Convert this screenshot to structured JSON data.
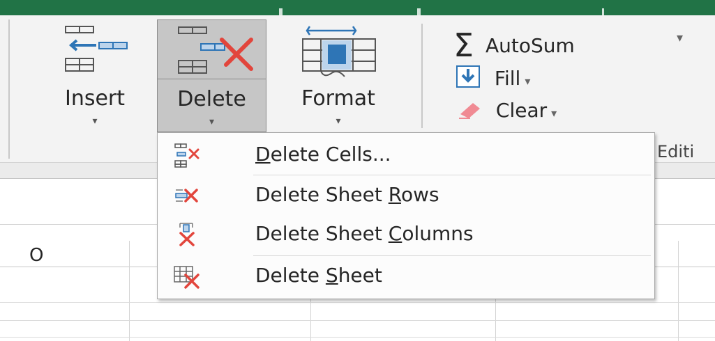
{
  "ribbon": {
    "cells_group": {
      "insert": {
        "label": "Insert",
        "dropdown_glyph": "▾",
        "icon": "insert-cells-icon"
      },
      "delete": {
        "label": "Delete",
        "dropdown_glyph": "▾",
        "icon": "delete-cells-icon",
        "state": "pressed"
      },
      "format": {
        "label": "Format",
        "dropdown_glyph": "▾",
        "icon": "format-cells-icon"
      }
    },
    "editing_group": {
      "autosum": {
        "label": "AutoSum",
        "dropdown_glyph": "▾",
        "icon": "sigma-icon"
      },
      "fill": {
        "label": "Fill",
        "dropdown_glyph": "▾",
        "icon": "fill-down-arrow-icon"
      },
      "clear": {
        "label": "Clear",
        "dropdown_glyph": "▾",
        "icon": "eraser-icon"
      },
      "group_label": "Editi"
    }
  },
  "grid": {
    "column_header": "O"
  },
  "delete_menu": {
    "items": [
      {
        "pre": "",
        "key": "D",
        "post": "elete Cells...",
        "icon": "delete-cells-icon"
      },
      {
        "pre": "Delete Sheet ",
        "key": "R",
        "post": "ows",
        "icon": "delete-rows-icon"
      },
      {
        "pre": "Delete Sheet ",
        "key": "C",
        "post": "olumns",
        "icon": "delete-columns-icon"
      },
      {
        "pre": "Delete ",
        "key": "S",
        "post": "heet",
        "icon": "delete-sheet-icon"
      }
    ]
  },
  "colors": {
    "title_bar": "#217346",
    "delete_x": "#e2453c",
    "icon_blue": "#2e75b6",
    "ribbon_bg": "#f3f3f3",
    "pressed_bg": "#c6c6c6"
  }
}
